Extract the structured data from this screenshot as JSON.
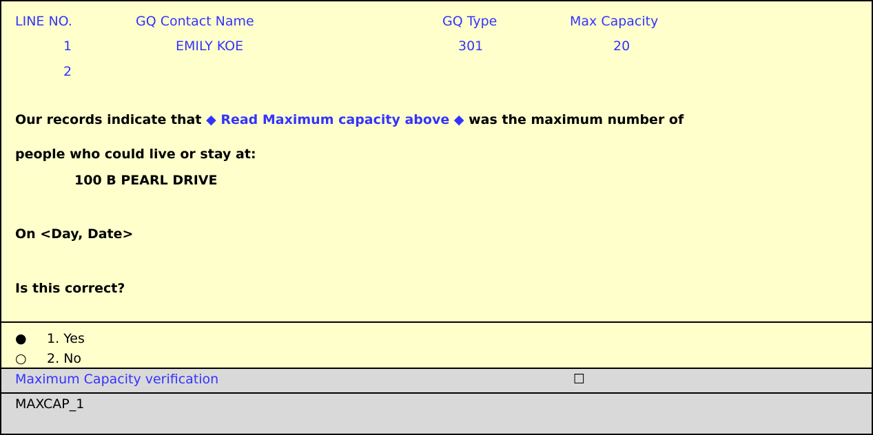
{
  "table": {
    "headers": [
      "LINE NO.",
      "GQ Contact Name",
      "GQ Type",
      "Max Capacity"
    ],
    "rows": [
      {
        "line": "1",
        "name": "EMILY KOE",
        "type": "301",
        "capacity": "20"
      },
      {
        "line": "2",
        "name": "",
        "type": "",
        "capacity": ""
      }
    ]
  },
  "question": {
    "part1": "Our records indicate that",
    "instruction": "◆ Read Maximum capacity above ◆",
    "part2": "was the maximum number of",
    "line2": "people who could live or stay at:",
    "address": "100 B PEARL DRIVE",
    "date_line": "On <Day, Date>",
    "confirm": "Is this correct?"
  },
  "options": [
    {
      "mark": "●",
      "label": "1. Yes",
      "selected": true
    },
    {
      "mark": "○",
      "label": "2. No",
      "selected": false
    }
  ],
  "verification": {
    "label": "Maximum Capacity verification",
    "checkbox": "☐"
  },
  "variable": "MAXCAP_1",
  "colors": {
    "background": "#ffffcc",
    "accent": "#3333ff",
    "footer": "#d9d9d9"
  }
}
